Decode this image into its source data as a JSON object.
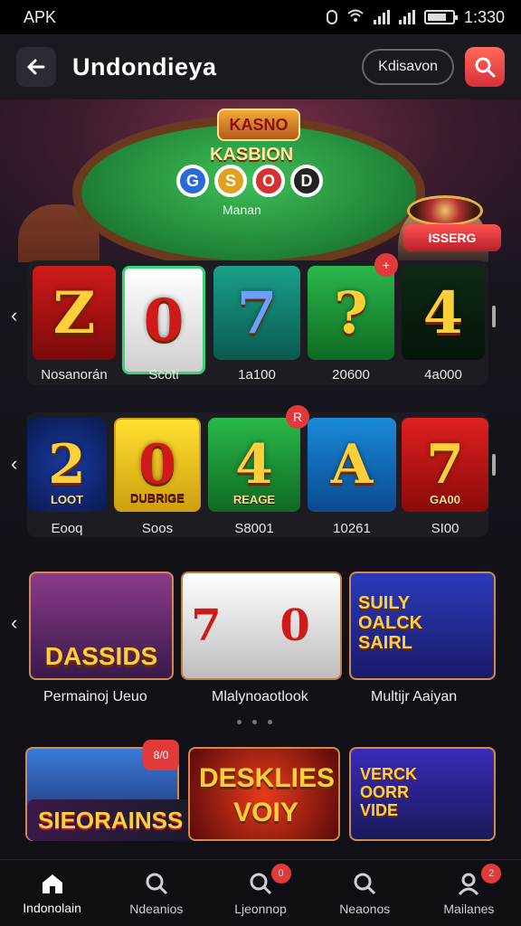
{
  "status": {
    "left": "APK",
    "time": "1:330"
  },
  "appbar": {
    "title": "Undondieya",
    "pill": "Kdisavon"
  },
  "hero": {
    "sign": "KASNO",
    "title": "KASBION",
    "sub": "Manan",
    "chips": [
      "G",
      "S",
      "O",
      "D"
    ],
    "badge": "ISSERG"
  },
  "row1": {
    "tiles": [
      {
        "glyph": "Z",
        "label": "Nosanorán"
      },
      {
        "glyph": "0",
        "label": "Scoti"
      },
      {
        "glyph": "7",
        "label": "1a100"
      },
      {
        "glyph": "?",
        "label": "20600"
      },
      {
        "glyph": "4",
        "label": "4a000"
      }
    ],
    "notif": "+"
  },
  "row2": {
    "tiles": [
      {
        "glyph": "2",
        "sub": "LOOT",
        "label": "Eooq"
      },
      {
        "glyph": "0",
        "sub": "DUBRIGE",
        "label": "Soos"
      },
      {
        "glyph": "4",
        "sub": "REAGE",
        "label": "S8001"
      },
      {
        "glyph": "A",
        "sub": "",
        "label": "10261"
      },
      {
        "glyph": "7",
        "sub": "GA00",
        "label": "SI00"
      }
    ],
    "notif": "R"
  },
  "row3": {
    "cards": [
      {
        "title": "DASSIDS",
        "label": "Permainoj Ueuo"
      },
      {
        "title": "7 0",
        "label": "Mlalynoaotlook"
      },
      {
        "title": "SUILY OALCK SAIRL",
        "label": "Multijr Aaiyan"
      }
    ]
  },
  "row4": {
    "cards": [
      {
        "title": "SIEORAINSS"
      },
      {
        "title": "DESKLIES VOIY"
      },
      {
        "title": "VERCK OORR VIDE"
      }
    ],
    "badge": "8/0"
  },
  "nav": [
    {
      "label": "Indonolain",
      "icon": "home-icon",
      "badge": ""
    },
    {
      "label": "Ndeanios",
      "icon": "search-icon",
      "badge": ""
    },
    {
      "label": "Ljeonnop",
      "icon": "search-icon",
      "badge": "0"
    },
    {
      "label": "Neaonos",
      "icon": "search-icon",
      "badge": ""
    },
    {
      "label": "Mailanes",
      "icon": "user-icon",
      "badge": "2"
    }
  ]
}
